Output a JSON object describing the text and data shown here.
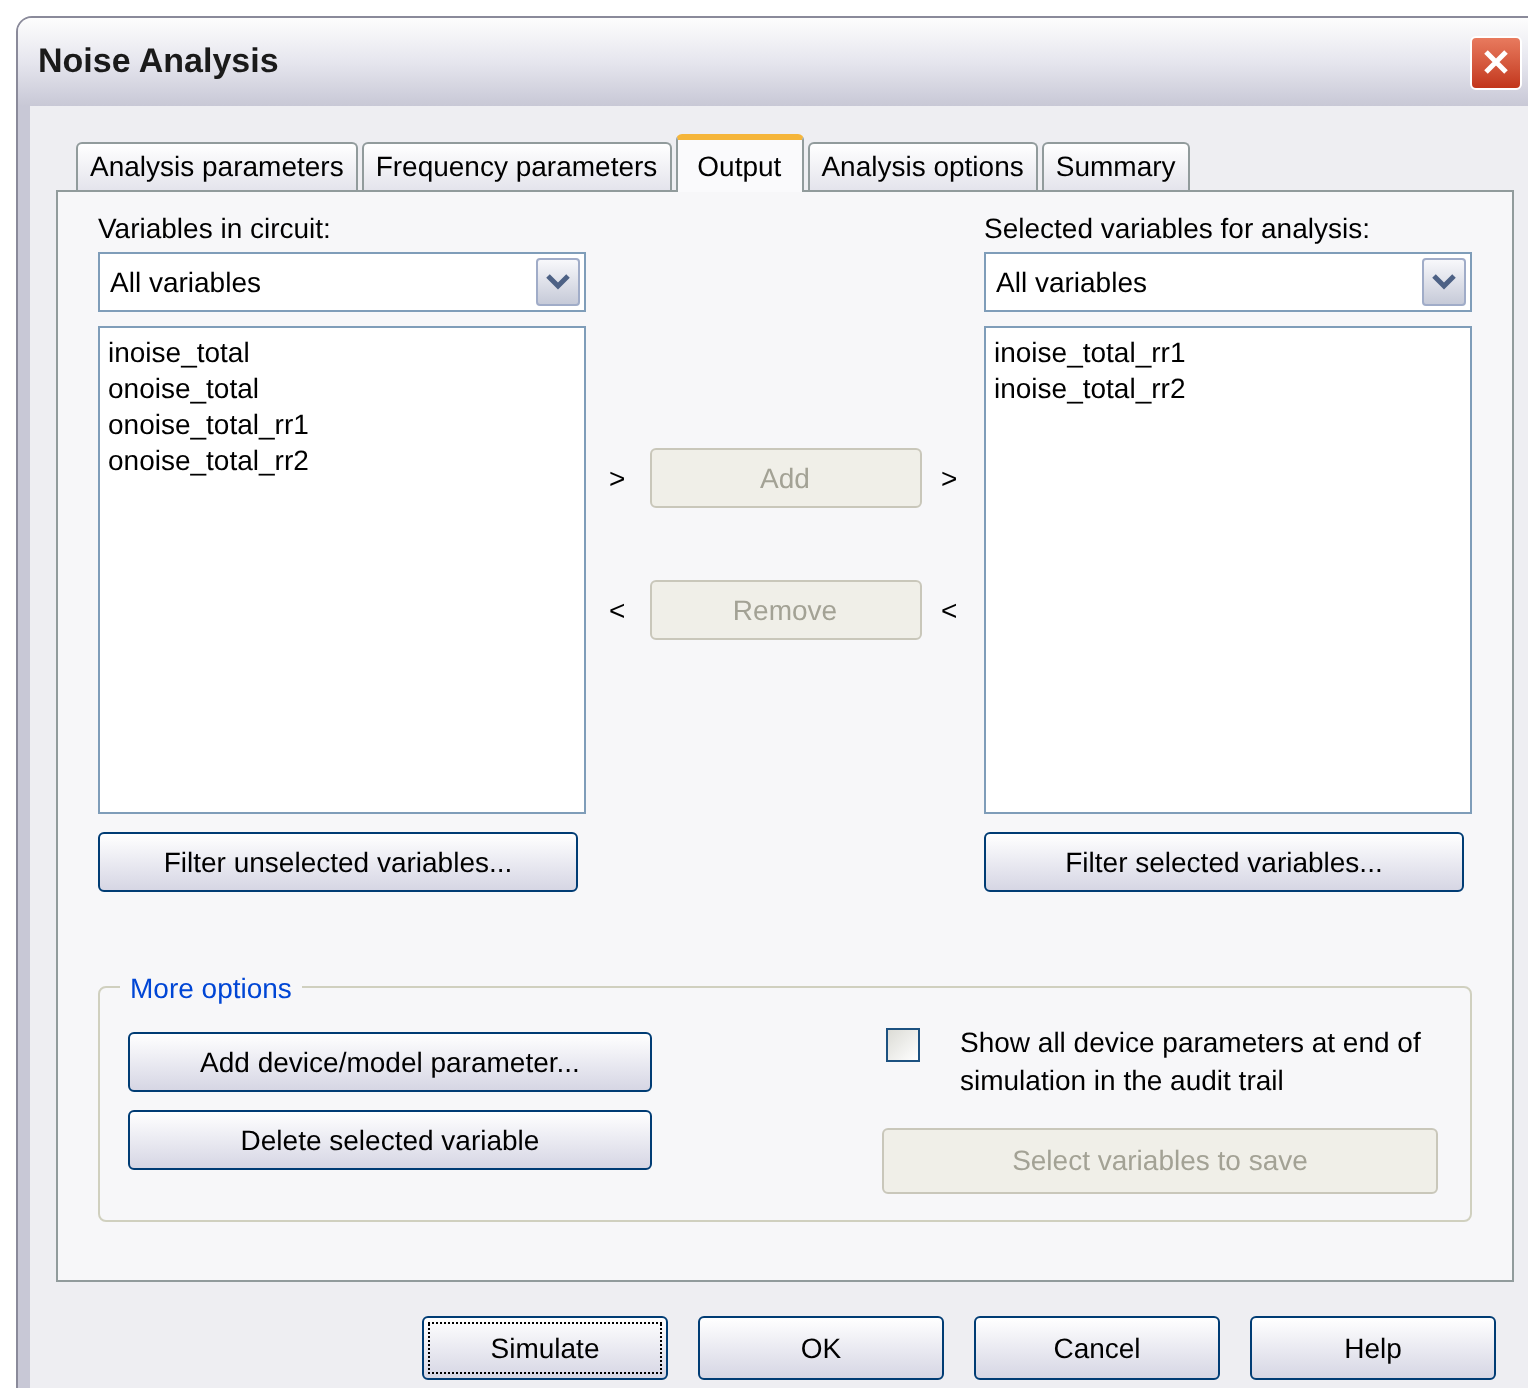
{
  "window": {
    "title": "Noise Analysis"
  },
  "tabs": [
    {
      "label": "Analysis parameters",
      "selected": false
    },
    {
      "label": "Frequency parameters",
      "selected": false
    },
    {
      "label": "Output",
      "selected": true
    },
    {
      "label": "Analysis options",
      "selected": false
    },
    {
      "label": "Summary",
      "selected": false
    }
  ],
  "left": {
    "label": "Variables in circuit:",
    "dropdown": "All variables",
    "items": [
      "inoise_total",
      "onoise_total",
      "onoise_total_rr1",
      "onoise_total_rr2"
    ],
    "filter_button": "Filter unselected variables..."
  },
  "middle": {
    "buttons": [
      {
        "label": "Add",
        "arrow": ">",
        "disabled": true
      },
      {
        "label": "Remove",
        "arrow": "<",
        "disabled": true
      }
    ]
  },
  "right": {
    "label": "Selected variables for analysis:",
    "dropdown": "All variables",
    "items": [
      "inoise_total_rr1",
      "inoise_total_rr2"
    ],
    "filter_button": "Filter selected variables..."
  },
  "more_options": {
    "title": "More options",
    "buttons": [
      "Add device/model parameter...",
      "Delete selected variable"
    ],
    "checkbox": {
      "label": "Show all device parameters at end of simulation in the audit trail",
      "checked": false
    },
    "save_button": {
      "label": "Select variables to save",
      "disabled": true
    }
  },
  "footer_buttons": [
    {
      "label": "Simulate",
      "focused": true
    },
    {
      "label": "OK",
      "focused": false
    },
    {
      "label": "Cancel",
      "focused": false
    },
    {
      "label": "Help",
      "focused": false
    }
  ]
}
